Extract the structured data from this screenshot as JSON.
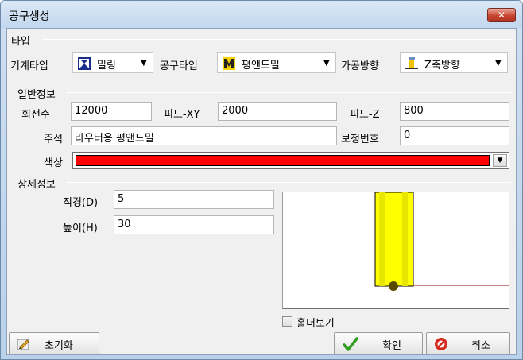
{
  "window": {
    "title": "공구생성",
    "close_label": "✕"
  },
  "type_section": {
    "heading": "타입",
    "machine_type_label": "기계타입",
    "machine_type_value": "밀링",
    "tool_type_label": "공구타입",
    "tool_type_value": "평앤드밀",
    "direction_label": "가공방향",
    "direction_value": "Z축방향"
  },
  "general_section": {
    "heading": "일반정보",
    "rpm_label": "회전수",
    "rpm_value": "12000",
    "feed_xy_label": "피드-XY",
    "feed_xy_value": "2000",
    "feed_z_label": "피드-Z",
    "feed_z_value": "800",
    "comment_label": "주석",
    "comment_value": "라우터용 평앤드밀",
    "offset_no_label": "보정번호",
    "offset_no_value": "0",
    "color_label": "색상",
    "color_value": "#ff0000"
  },
  "detail_section": {
    "heading": "상세정보",
    "diameter_label": "직경(D)",
    "diameter_value": "5",
    "height_label": "높이(H)",
    "height_value": "30",
    "holder_view_label": "홀더보기",
    "holder_view_checked": false
  },
  "buttons": {
    "reset_label": "초기화",
    "ok_label": "확인",
    "cancel_label": "취소"
  }
}
